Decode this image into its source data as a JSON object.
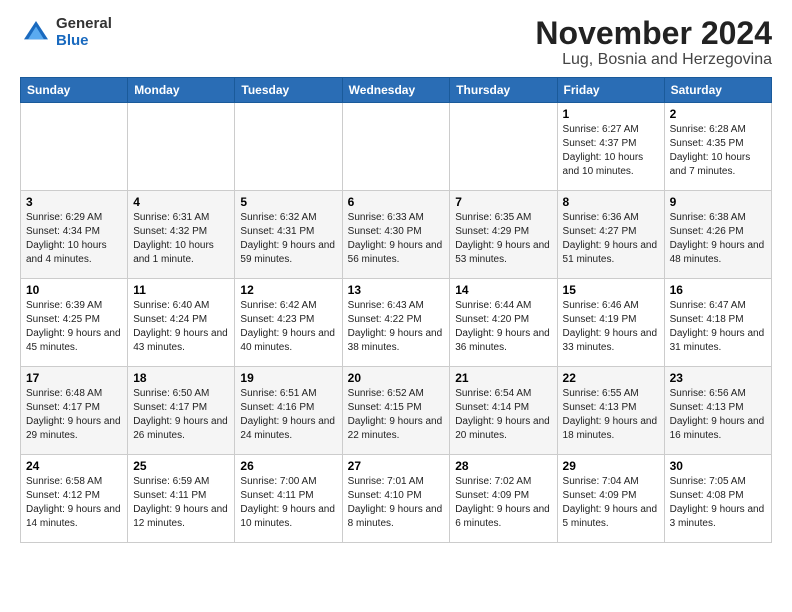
{
  "logo": {
    "general": "General",
    "blue": "Blue"
  },
  "title": "November 2024",
  "subtitle": "Lug, Bosnia and Herzegovina",
  "days_of_week": [
    "Sunday",
    "Monday",
    "Tuesday",
    "Wednesday",
    "Thursday",
    "Friday",
    "Saturday"
  ],
  "weeks": [
    [
      {
        "day": "",
        "info": ""
      },
      {
        "day": "",
        "info": ""
      },
      {
        "day": "",
        "info": ""
      },
      {
        "day": "",
        "info": ""
      },
      {
        "day": "",
        "info": ""
      },
      {
        "day": "1",
        "info": "Sunrise: 6:27 AM\nSunset: 4:37 PM\nDaylight: 10 hours\nand 10 minutes."
      },
      {
        "day": "2",
        "info": "Sunrise: 6:28 AM\nSunset: 4:35 PM\nDaylight: 10 hours\nand 7 minutes."
      }
    ],
    [
      {
        "day": "3",
        "info": "Sunrise: 6:29 AM\nSunset: 4:34 PM\nDaylight: 10 hours\nand 4 minutes."
      },
      {
        "day": "4",
        "info": "Sunrise: 6:31 AM\nSunset: 4:32 PM\nDaylight: 10 hours\nand 1 minute."
      },
      {
        "day": "5",
        "info": "Sunrise: 6:32 AM\nSunset: 4:31 PM\nDaylight: 9 hours\nand 59 minutes."
      },
      {
        "day": "6",
        "info": "Sunrise: 6:33 AM\nSunset: 4:30 PM\nDaylight: 9 hours\nand 56 minutes."
      },
      {
        "day": "7",
        "info": "Sunrise: 6:35 AM\nSunset: 4:29 PM\nDaylight: 9 hours\nand 53 minutes."
      },
      {
        "day": "8",
        "info": "Sunrise: 6:36 AM\nSunset: 4:27 PM\nDaylight: 9 hours\nand 51 minutes."
      },
      {
        "day": "9",
        "info": "Sunrise: 6:38 AM\nSunset: 4:26 PM\nDaylight: 9 hours\nand 48 minutes."
      }
    ],
    [
      {
        "day": "10",
        "info": "Sunrise: 6:39 AM\nSunset: 4:25 PM\nDaylight: 9 hours\nand 45 minutes."
      },
      {
        "day": "11",
        "info": "Sunrise: 6:40 AM\nSunset: 4:24 PM\nDaylight: 9 hours\nand 43 minutes."
      },
      {
        "day": "12",
        "info": "Sunrise: 6:42 AM\nSunset: 4:23 PM\nDaylight: 9 hours\nand 40 minutes."
      },
      {
        "day": "13",
        "info": "Sunrise: 6:43 AM\nSunset: 4:22 PM\nDaylight: 9 hours\nand 38 minutes."
      },
      {
        "day": "14",
        "info": "Sunrise: 6:44 AM\nSunset: 4:20 PM\nDaylight: 9 hours\nand 36 minutes."
      },
      {
        "day": "15",
        "info": "Sunrise: 6:46 AM\nSunset: 4:19 PM\nDaylight: 9 hours\nand 33 minutes."
      },
      {
        "day": "16",
        "info": "Sunrise: 6:47 AM\nSunset: 4:18 PM\nDaylight: 9 hours\nand 31 minutes."
      }
    ],
    [
      {
        "day": "17",
        "info": "Sunrise: 6:48 AM\nSunset: 4:17 PM\nDaylight: 9 hours\nand 29 minutes."
      },
      {
        "day": "18",
        "info": "Sunrise: 6:50 AM\nSunset: 4:17 PM\nDaylight: 9 hours\nand 26 minutes."
      },
      {
        "day": "19",
        "info": "Sunrise: 6:51 AM\nSunset: 4:16 PM\nDaylight: 9 hours\nand 24 minutes."
      },
      {
        "day": "20",
        "info": "Sunrise: 6:52 AM\nSunset: 4:15 PM\nDaylight: 9 hours\nand 22 minutes."
      },
      {
        "day": "21",
        "info": "Sunrise: 6:54 AM\nSunset: 4:14 PM\nDaylight: 9 hours\nand 20 minutes."
      },
      {
        "day": "22",
        "info": "Sunrise: 6:55 AM\nSunset: 4:13 PM\nDaylight: 9 hours\nand 18 minutes."
      },
      {
        "day": "23",
        "info": "Sunrise: 6:56 AM\nSunset: 4:13 PM\nDaylight: 9 hours\nand 16 minutes."
      }
    ],
    [
      {
        "day": "24",
        "info": "Sunrise: 6:58 AM\nSunset: 4:12 PM\nDaylight: 9 hours\nand 14 minutes."
      },
      {
        "day": "25",
        "info": "Sunrise: 6:59 AM\nSunset: 4:11 PM\nDaylight: 9 hours\nand 12 minutes."
      },
      {
        "day": "26",
        "info": "Sunrise: 7:00 AM\nSunset: 4:11 PM\nDaylight: 9 hours\nand 10 minutes."
      },
      {
        "day": "27",
        "info": "Sunrise: 7:01 AM\nSunset: 4:10 PM\nDaylight: 9 hours\nand 8 minutes."
      },
      {
        "day": "28",
        "info": "Sunrise: 7:02 AM\nSunset: 4:09 PM\nDaylight: 9 hours\nand 6 minutes."
      },
      {
        "day": "29",
        "info": "Sunrise: 7:04 AM\nSunset: 4:09 PM\nDaylight: 9 hours\nand 5 minutes."
      },
      {
        "day": "30",
        "info": "Sunrise: 7:05 AM\nSunset: 4:08 PM\nDaylight: 9 hours\nand 3 minutes."
      }
    ]
  ]
}
